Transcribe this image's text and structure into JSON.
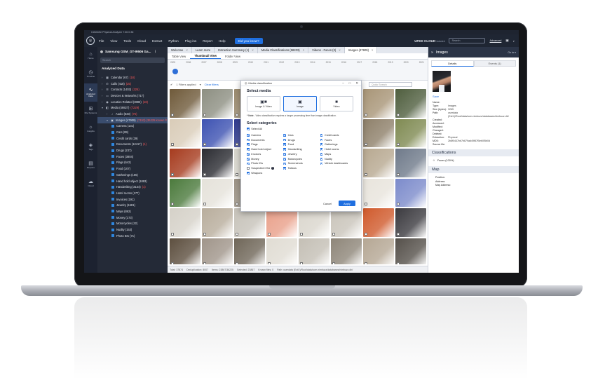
{
  "window": {
    "title": "Cellebrite Physical Analyzer 7.60.0.36"
  },
  "menu": {
    "items": [
      "File",
      "View",
      "Tools",
      "Cloud",
      "Extract",
      "Python",
      "Plug-ins",
      "Report",
      "Help"
    ],
    "did_you_know": "Did you know?",
    "cloud_label": "UFED CLOUD",
    "cloud_suffix": "included",
    "search_placeholder": "Search",
    "advanced": "Advanced"
  },
  "leftnav": [
    {
      "label": "Home",
      "icon": "home-icon",
      "glyph": "⌂"
    },
    {
      "label": "Timeline",
      "icon": "clock-icon",
      "glyph": "◷"
    },
    {
      "label": "Analyzed Data",
      "icon": "pulse-icon",
      "glyph": "∿"
    },
    {
      "label": "File Systems",
      "icon": "tree-icon",
      "glyph": "⊞"
    },
    {
      "label": "Insights",
      "icon": "bulb-icon",
      "glyph": "☼"
    },
    {
      "label": "Tags",
      "icon": "tag-icon",
      "glyph": "◈"
    },
    {
      "label": "Reports",
      "icon": "report-icon",
      "glyph": "▤"
    },
    {
      "label": "Cloud",
      "icon": "cloud-icon",
      "glyph": "☁"
    }
  ],
  "tree": {
    "device": "Samsung GSM_GT-I9506 Ga...",
    "search_placeholder": "Search",
    "heading": "Analyzed Data",
    "items": [
      {
        "label": "Calendar (67)",
        "new": "(18)",
        "icon": "▦",
        "level": 0
      },
      {
        "label": "Calls (418)",
        "new": "(25)",
        "icon": "✆",
        "level": 0
      },
      {
        "label": "Contacts (1403)",
        "new": "(325)",
        "icon": "☰",
        "level": 0
      },
      {
        "label": "Devices & Networks (717)",
        "new": "",
        "icon": "▭",
        "level": 0
      },
      {
        "label": "Location Related (3883)",
        "new": "(18)",
        "icon": "◉",
        "level": 0
      },
      {
        "label": "Media (49827)",
        "new": "(7229)",
        "icon": "◧",
        "level": 0
      },
      {
        "label": "Audio (633)",
        "new": "(76)",
        "icon": "♪",
        "level": 1
      },
      {
        "label": "Images (47909)",
        "new": "(7153) (36225 known fr",
        "icon": "▣",
        "level": 1
      },
      {
        "label": "Camera (131)",
        "new": "",
        "level": 2
      },
      {
        "label": "Cars (89)",
        "new": "",
        "level": 2
      },
      {
        "label": "Credit cards (29)",
        "new": "",
        "level": 2
      },
      {
        "label": "Documents (12417)",
        "new": "(1)",
        "level": 2
      },
      {
        "label": "Drugs (237)",
        "new": "",
        "level": 2
      },
      {
        "label": "Faces (3804)",
        "new": "",
        "level": 2
      },
      {
        "label": "Flags (642)",
        "new": "",
        "level": 2
      },
      {
        "label": "Food (107)",
        "new": "",
        "level": 2
      },
      {
        "label": "Gatherings (165)",
        "new": "",
        "level": 2
      },
      {
        "label": "Hand hold object (1893)",
        "new": "",
        "level": 2
      },
      {
        "label": "Handwriting (3134)",
        "new": "(1)",
        "level": 2
      },
      {
        "label": "Hotel rooms (177)",
        "new": "",
        "level": 2
      },
      {
        "label": "Invoices (191)",
        "new": "",
        "level": 2
      },
      {
        "label": "Jewelry (1681)",
        "new": "",
        "level": 2
      },
      {
        "label": "Maps (862)",
        "new": "",
        "level": 2
      },
      {
        "label": "Money (173)",
        "new": "",
        "level": 2
      },
      {
        "label": "Motorcycles (22)",
        "new": "",
        "level": 2
      },
      {
        "label": "Nudity (153)",
        "new": "",
        "level": 2
      },
      {
        "label": "Photo IDs (71)",
        "new": "",
        "level": 2
      }
    ]
  },
  "tabs": [
    {
      "label": "Welcome",
      "close": true,
      "active": false
    },
    {
      "label": "Learn more",
      "close": false,
      "active": false
    },
    {
      "label": "Extraction Summary (1)",
      "close": true,
      "active": false
    },
    {
      "label": "Media Classifications (58203)",
      "close": true,
      "active": false
    },
    {
      "label": "Videos - Faces (3)",
      "close": true,
      "active": false
    },
    {
      "label": "Images (47909)",
      "close": true,
      "active": true
    }
  ],
  "subtabs": [
    "Table View",
    "Thumbnail View",
    "Folder View"
  ],
  "timeline_years": [
    "2005",
    "2006",
    "2007",
    "2008",
    "2009",
    "2010",
    "2011",
    "2012",
    "2013",
    "2014",
    "2015",
    "2016",
    "2017",
    "2018",
    "2019",
    "2020",
    "2021"
  ],
  "filter": {
    "applied": "1 Filters applied",
    "clear": "Clear filters",
    "search_placeholder": "Quick Search"
  },
  "thumb_colors": [
    "#6f5a3a",
    "#8d8f82",
    "#9a8a6e",
    "#cfc6b5",
    "#d6d2c8",
    "#5c4a34",
    "#a89577",
    "#4f5e3e",
    "#d9ccb8",
    "#3d52b2",
    "#2f3a8f",
    "#5c5f58",
    "#e7e4dd",
    "#cbc8bf",
    "#8e806a",
    "#7f8a52",
    "#a63b1e",
    "#2a2b31",
    "#d7d5cc",
    "#d4bda2",
    "#c7b59b",
    "#c6c3bb",
    "#b7a890",
    "#6f7a8a",
    "#4b7a3c",
    "#e5e2da",
    "#9c9385",
    "#5a574f",
    "#7e6d5a",
    "#c9c6be",
    "#e8e4dc",
    "#7c8bcb",
    "#d5d1c8",
    "#b8ad9c",
    "#c6c2b9",
    "#e9a08a",
    "#dad6cd",
    "#c9c4ba",
    "#d05a2c",
    "#3b3a3f",
    "#5d4f3f",
    "#a0958a",
    "#6f6658",
    "#e0dcd3",
    "#c4bfb5",
    "#8e8679",
    "#b5a794",
    "#55504a"
  ],
  "status": {
    "total": "Total: 37874",
    "dedup": "Deduplication: 8007",
    "items": "Items: 23867/36225",
    "selected": "Selected: 23867",
    "known": "Known files: 0",
    "path": "Path: userdata (ExtX)/Root/data/com.nimbuzz/databases/nimbuzz.db/"
  },
  "right": {
    "title": "Images",
    "goto": "Go to",
    "tabs": [
      "Details",
      "Events (1)"
    ],
    "save": "Save",
    "fields": [
      {
        "k": "Name:",
        "v": ""
      },
      {
        "k": "Type:",
        "v": "Images"
      },
      {
        "k": "Size (bytes):",
        "v": "3265"
      },
      {
        "k": "Path:",
        "v": "userdata (ExtX)/Root/data/com.nimbuzz/databases/nimbuzz.db/"
      },
      {
        "k": "Created:",
        "v": ""
      },
      {
        "k": "Accessed:",
        "v": ""
      },
      {
        "k": "Modified:",
        "v": ""
      },
      {
        "k": "Changed:",
        "v": ""
      },
      {
        "k": "Deleted:",
        "v": ""
      },
      {
        "k": "Extraction:",
        "v": "Physical"
      },
      {
        "k": "MD5:",
        "v": "2b8f0447bb7b679ad49f87f5eb0f5b0d"
      },
      {
        "k": "Source file:",
        "v": ""
      }
    ],
    "classifications_title": "Classifications",
    "faces": "Faces (100%)",
    "map_title": "Map",
    "map_fields": [
      "Position:",
      "Address:",
      "Map Address:"
    ]
  },
  "dialog": {
    "window_title": "Media classification",
    "heading": "Select media",
    "media_options": [
      {
        "label": "Image & Video",
        "icon": "image-video-icon",
        "glyph": "▣■",
        "active": false
      },
      {
        "label": "Image",
        "icon": "image-icon",
        "glyph": "▣",
        "active": true
      },
      {
        "label": "Video",
        "icon": "video-icon",
        "glyph": "■",
        "active": false
      }
    ],
    "note_prefix": "* Note",
    "note": " - Video classification requires a longer processing time than image classification.",
    "categories_heading": "Select categories",
    "select_all": "Select All",
    "categories": [
      {
        "label": "Camera",
        "checked": true
      },
      {
        "label": "Cars",
        "checked": true
      },
      {
        "label": "Credit cards",
        "checked": true
      },
      {
        "label": "Documents",
        "checked": true
      },
      {
        "label": "Drugs",
        "checked": true
      },
      {
        "label": "Faces",
        "checked": true
      },
      {
        "label": "Flags",
        "checked": true
      },
      {
        "label": "Food",
        "checked": true
      },
      {
        "label": "Gatherings",
        "checked": true
      },
      {
        "label": "Hand hold object",
        "checked": true
      },
      {
        "label": "Handwriting",
        "checked": true
      },
      {
        "label": "Hotel rooms",
        "checked": true
      },
      {
        "label": "Invoices",
        "checked": true
      },
      {
        "label": "Jewelry",
        "checked": true
      },
      {
        "label": "Maps",
        "checked": true
      },
      {
        "label": "Money",
        "checked": true
      },
      {
        "label": "Motorcycles",
        "checked": true
      },
      {
        "label": "Nudity",
        "checked": true
      },
      {
        "label": "Photo IDs",
        "checked": true
      },
      {
        "label": "Screenshots",
        "checked": true
      },
      {
        "label": "Vehicle dashboards",
        "checked": true
      },
      {
        "label": "Suspected CSA",
        "checked": false,
        "info": true
      },
      {
        "label": "Tattoos",
        "checked": true
      },
      {
        "label": "",
        "checked": null
      },
      {
        "label": "Weapons",
        "checked": true
      }
    ],
    "cancel": "Cancel",
    "apply": "Apply"
  }
}
